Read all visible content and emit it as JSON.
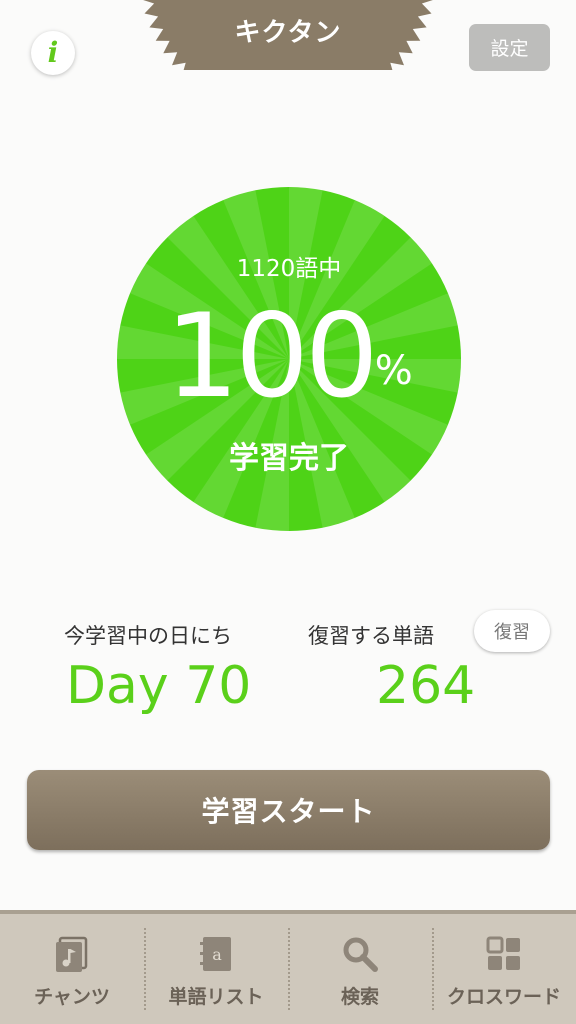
{
  "header": {
    "title": "キクタン",
    "info_label": "i",
    "settings_label": "設定"
  },
  "progress": {
    "total_label": "1120語中",
    "percent": "100",
    "percent_sign": "%",
    "status": "学習完了",
    "fraction": 1.0
  },
  "stats": {
    "current_day_label": "今学習中の日にち",
    "current_day_value": "Day 70",
    "review_words_label": "復習する単語",
    "review_words_value": "264",
    "review_button_label": "復習"
  },
  "start_button_label": "学習スタート",
  "tabs": [
    {
      "label": "チャンツ",
      "icon": "music-note-icon"
    },
    {
      "label": "単語リスト",
      "icon": "notebook-icon"
    },
    {
      "label": "検索",
      "icon": "magnifier-icon"
    },
    {
      "label": "クロスワード",
      "icon": "grid-icon"
    }
  ],
  "colors": {
    "accent_green": "#5ad01a",
    "circle_green": "#4ed317",
    "brown": "#7d6f5c",
    "tab_bar": "#cfc8bc"
  }
}
